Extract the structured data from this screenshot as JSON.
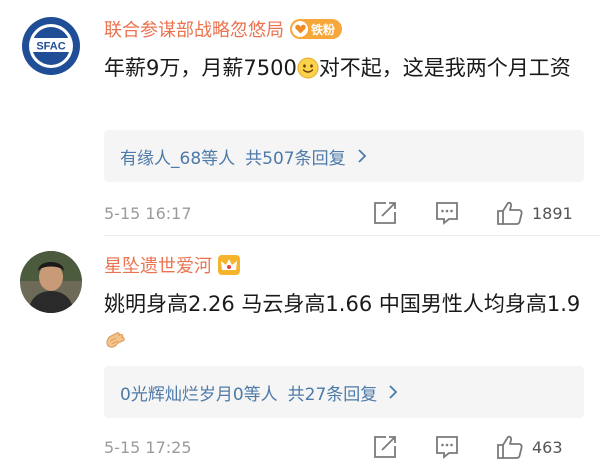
{
  "comments": [
    {
      "username": "联合参谋部战略忽悠局",
      "fan_badge": "铁粉",
      "avatar_text": "SFAC",
      "text_before_emoji": "年薪9万，月薪7500",
      "text_after_emoji": "对不起，这是我两个月工资",
      "reply_summary": "有缘人_68等人",
      "reply_count": "共507条回复",
      "timestamp": "5-15 16:17",
      "likes": "1891"
    },
    {
      "username": "星坠遗世爱河",
      "text_before_emoji": "姚明身高2.26  马云身高1.66 中国男性人均身高1.9",
      "reply_summary": "0光辉灿烂岁月0等人",
      "reply_count": "共27条回复",
      "timestamp": "5-15 17:25",
      "likes": "463"
    }
  ],
  "icons": {
    "crown": "crown-icon",
    "heart": "heart-icon",
    "smile": "smile-emoji-icon",
    "clap": "clap-emoji-icon",
    "repost": "repost-icon",
    "comment": "comment-icon",
    "like": "thumbs-up-icon",
    "chevron": "chevron-right-icon"
  },
  "colors": {
    "username": "#eb7350",
    "link": "#4d7aa8",
    "badge": "#f7a63a",
    "meta": "#9b9b9b"
  }
}
